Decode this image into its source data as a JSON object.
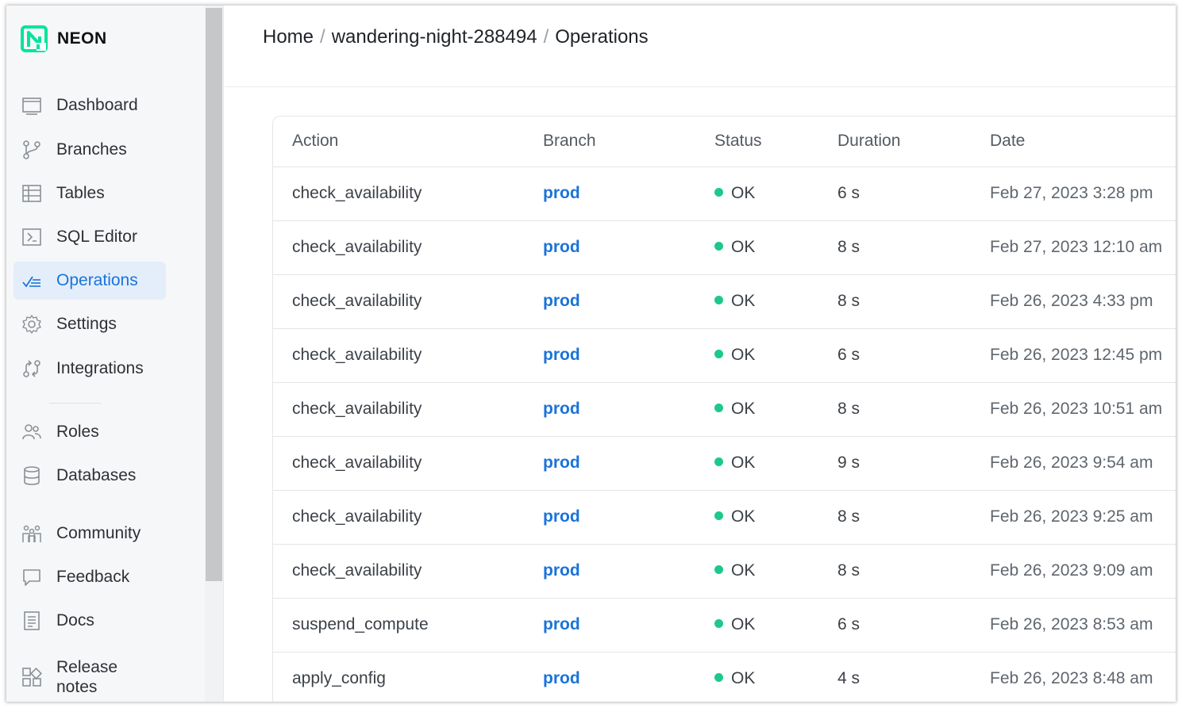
{
  "app": {
    "name": "NEON",
    "brand_color": "#00e599",
    "accent": "#1a73d9"
  },
  "breadcrumb": {
    "home": "Home",
    "project": "wandering-night-288494",
    "current": "Operations",
    "separator": "/"
  },
  "sidebar": {
    "items": [
      {
        "label": "Dashboard",
        "icon": "dashboard-icon"
      },
      {
        "label": "Branches",
        "icon": "branches-icon"
      },
      {
        "label": "Tables",
        "icon": "tables-icon"
      },
      {
        "label": "SQL Editor",
        "icon": "sql-editor-icon"
      },
      {
        "label": "Operations",
        "icon": "operations-icon",
        "active": true
      },
      {
        "label": "Settings",
        "icon": "gear-icon"
      },
      {
        "label": "Integrations",
        "icon": "integrations-icon"
      },
      {
        "label": "Roles",
        "icon": "roles-icon"
      },
      {
        "label": "Databases",
        "icon": "database-icon"
      },
      {
        "label": "Community",
        "icon": "community-icon"
      },
      {
        "label": "Feedback",
        "icon": "feedback-icon"
      },
      {
        "label": "Docs",
        "icon": "docs-icon"
      },
      {
        "label": "Release notes",
        "icon": "release-notes-icon"
      }
    ]
  },
  "table": {
    "columns": [
      "Action",
      "Branch",
      "Status",
      "Duration",
      "Date"
    ],
    "rows": [
      {
        "action": "check_availability",
        "branch": "prod",
        "status": "OK",
        "duration": "6 s",
        "date": "Feb 27, 2023 3:28 pm"
      },
      {
        "action": "check_availability",
        "branch": "prod",
        "status": "OK",
        "duration": "8 s",
        "date": "Feb 27, 2023 12:10 am"
      },
      {
        "action": "check_availability",
        "branch": "prod",
        "status": "OK",
        "duration": "8 s",
        "date": "Feb 26, 2023 4:33 pm"
      },
      {
        "action": "check_availability",
        "branch": "prod",
        "status": "OK",
        "duration": "6 s",
        "date": "Feb 26, 2023 12:45 pm"
      },
      {
        "action": "check_availability",
        "branch": "prod",
        "status": "OK",
        "duration": "8 s",
        "date": "Feb 26, 2023 10:51 am"
      },
      {
        "action": "check_availability",
        "branch": "prod",
        "status": "OK",
        "duration": "9 s",
        "date": "Feb 26, 2023 9:54 am"
      },
      {
        "action": "check_availability",
        "branch": "prod",
        "status": "OK",
        "duration": "8 s",
        "date": "Feb 26, 2023 9:25 am"
      },
      {
        "action": "check_availability",
        "branch": "prod",
        "status": "OK",
        "duration": "8 s",
        "date": "Feb 26, 2023 9:09 am"
      },
      {
        "action": "suspend_compute",
        "branch": "prod",
        "status": "OK",
        "duration": "6 s",
        "date": "Feb 26, 2023 8:53 am"
      },
      {
        "action": "apply_config",
        "branch": "prod",
        "status": "OK",
        "duration": "4 s",
        "date": "Feb 26, 2023 8:48 am"
      }
    ]
  },
  "colors": {
    "status_ok": "#1dc98a",
    "sidebar_bg": "#f6f7f9",
    "active_bg": "#e4eefb"
  }
}
